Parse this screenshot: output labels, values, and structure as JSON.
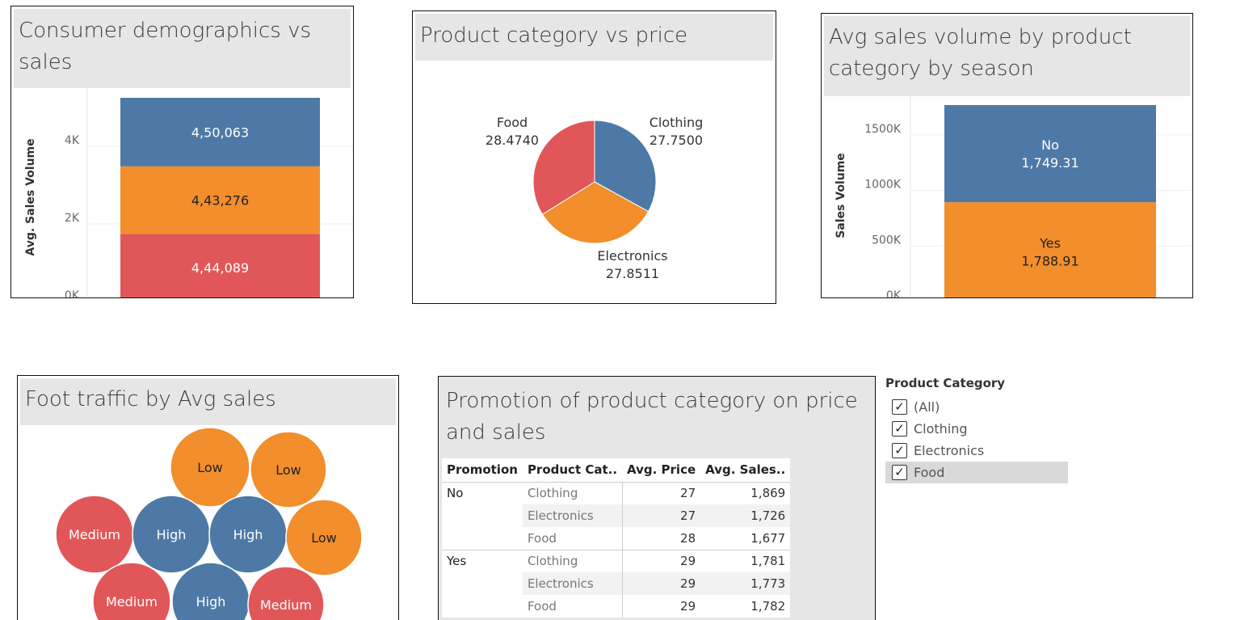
{
  "panels": {
    "demographics": {
      "title": "Consumer demographics vs sales"
    },
    "category_price": {
      "title": "Product category vs price"
    },
    "season": {
      "title": "Avg sales volume by product category by season"
    },
    "foot_traffic": {
      "title": "Foot traffic by Avg sales"
    },
    "promotion": {
      "title": "Promotion of product category on price and sales"
    }
  },
  "colors": {
    "blue": "#4e79a7",
    "orange": "#f28e2b",
    "red": "#e15759"
  },
  "chart_data": [
    {
      "type": "bar",
      "name": "demographics",
      "ylabel": "Avg. Sales Volume",
      "yticks": [
        "0K",
        "2K",
        "4K"
      ],
      "ylim": [
        0,
        5300
      ],
      "stack": [
        {
          "value": 4440.89,
          "label": "4,44,089",
          "color": "#e15759"
        },
        {
          "value": 4432.76,
          "label": "4,43,276",
          "color": "#f28e2b"
        },
        {
          "value": 4500.63,
          "label": "4,50,063",
          "color": "#4e79a7"
        }
      ]
    },
    {
      "type": "pie",
      "name": "category_price",
      "slices": [
        {
          "label": "Clothing",
          "value": 27.75,
          "value_label": "27.7500",
          "color": "#4e79a7"
        },
        {
          "label": "Electronics",
          "value": 27.8511,
          "value_label": "27.8511",
          "color": "#f28e2b"
        },
        {
          "label": "Food",
          "value": 28.474,
          "value_label": "28.4740",
          "color": "#e15759"
        }
      ]
    },
    {
      "type": "bar",
      "name": "season",
      "ylabel": "Sales Volume",
      "yticks": [
        "0K",
        "500K",
        "1000K",
        "1500K"
      ],
      "ylim": [
        0,
        1800
      ],
      "stack": [
        {
          "value": 1788.91,
          "name": "Yes",
          "label": "1,788.91",
          "color": "#f28e2b"
        },
        {
          "value": 1749.31,
          "name": "No",
          "label": "1,749.31",
          "color": "#4e79a7"
        }
      ]
    },
    {
      "type": "bubble",
      "name": "foot_traffic",
      "bubbles": [
        {
          "label": "Low",
          "color": "#f28e2b"
        },
        {
          "label": "Low",
          "color": "#f28e2b"
        },
        {
          "label": "Medium",
          "color": "#e15759"
        },
        {
          "label": "High",
          "color": "#4e79a7"
        },
        {
          "label": "High",
          "color": "#4e79a7"
        },
        {
          "label": "Low",
          "color": "#f28e2b"
        },
        {
          "label": "Medium",
          "color": "#e15759"
        },
        {
          "label": "High",
          "color": "#4e79a7"
        },
        {
          "label": "Medium",
          "color": "#e15759"
        }
      ]
    },
    {
      "type": "table",
      "name": "promotion",
      "columns": [
        "Promotion",
        "Product Cat..",
        "Avg. Price",
        "Avg. Sales.."
      ],
      "groups": [
        {
          "promotion": "No",
          "rows": [
            [
              "Clothing",
              "27",
              "1,869"
            ],
            [
              "Electronics",
              "27",
              "1,726"
            ],
            [
              "Food",
              "28",
              "1,677"
            ]
          ]
        },
        {
          "promotion": "Yes",
          "rows": [
            [
              "Clothing",
              "29",
              "1,781"
            ],
            [
              "Electronics",
              "29",
              "1,773"
            ],
            [
              "Food",
              "29",
              "1,782"
            ]
          ]
        }
      ]
    }
  ],
  "filter": {
    "title": "Product Category",
    "check_glyph": "✓",
    "items": [
      {
        "label": "(All)",
        "checked": true
      },
      {
        "label": "Clothing",
        "checked": true
      },
      {
        "label": "Electronics",
        "checked": true
      },
      {
        "label": "Food",
        "checked": true,
        "selected": true
      }
    ]
  }
}
